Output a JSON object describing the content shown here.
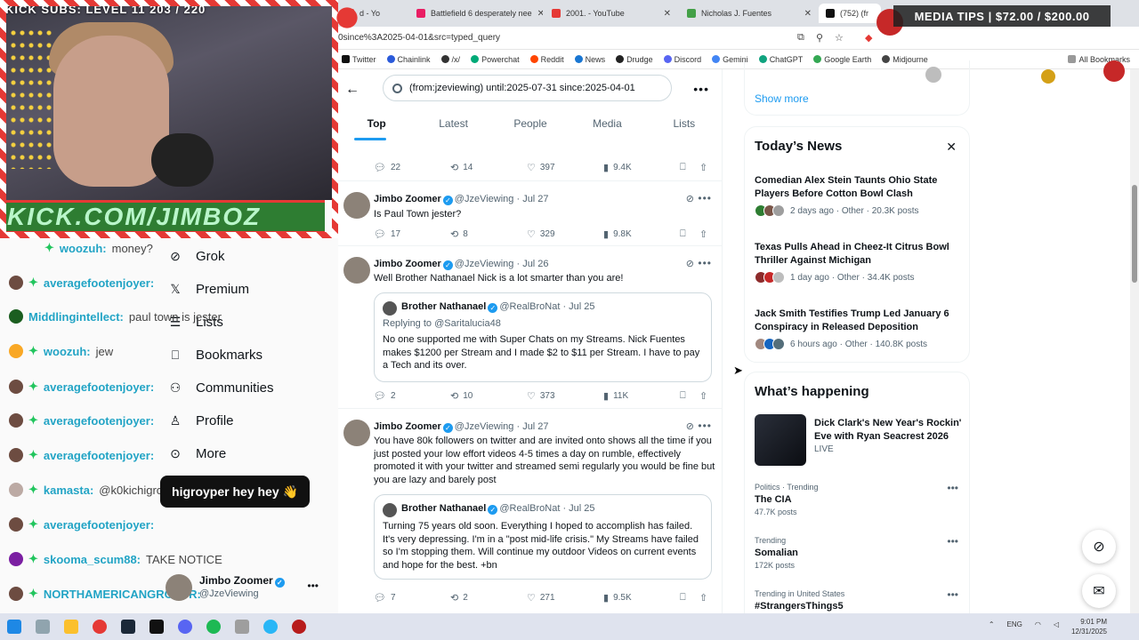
{
  "browser": {
    "tabs": [
      {
        "label": "d - Yo",
        "color": "#e53935"
      },
      {
        "label": "Battlefield 6 desperately nee",
        "color": "#e91e63"
      },
      {
        "label": "2001. - YouTube",
        "color": "#e53935"
      },
      {
        "label": "Nicholas J. Fuentes",
        "color": "#43a047"
      },
      {
        "label": "(752) (fr",
        "color": "#111111"
      }
    ],
    "url": "0since%3A2025-04-01&src=typed_query",
    "bookmarks": [
      "Twitter",
      "Chainlink",
      "/x/",
      "Powerchat",
      "Reddit",
      "News",
      "Drudge",
      "Discord",
      "Gemini",
      "ChatGPT",
      "Google Earth",
      "Midjourne"
    ],
    "all_bookmarks": "All Bookmarks"
  },
  "search": {
    "query": "(from:jzeviewing) until:2025-07-31 since:2025-04-01",
    "tabs": [
      "Top",
      "Latest",
      "People",
      "Media",
      "Lists"
    ]
  },
  "first_actions": {
    "replies": "22",
    "reposts": "14",
    "likes": "397",
    "views": "9.4K"
  },
  "tweets": [
    {
      "name": "Jimbo Zoomer",
      "handle": "@JzeViewing",
      "date": "· Jul 27",
      "text": "Is Paul Town jester?",
      "replies": "17",
      "reposts": "8",
      "likes": "329",
      "views": "9.8K"
    },
    {
      "name": "Jimbo Zoomer",
      "handle": "@JzeViewing",
      "date": "· Jul 26",
      "text": "Well Brother Nathanael Nick is a lot smarter than you are!",
      "quote": {
        "name": "Brother Nathanael",
        "handle": "@RealBroNat",
        "date": "· Jul 25",
        "reply": "Replying to @Saritalucia48",
        "text": "No one supported me with Super Chats on my Streams. Nick Fuentes makes $1200 per Stream and I made $2 to $11 per Stream. I have to pay a Tech and its over."
      },
      "replies": "2",
      "reposts": "10",
      "likes": "373",
      "views": "11K"
    },
    {
      "name": "Jimbo Zoomer",
      "handle": "@JzeViewing",
      "date": "· Jul 27",
      "text": "You have 80k followers on twitter and are invited onto shows all the time if you just posted your low effort videos 4-5 times a day on rumble, effectively promoted it with your twitter and streamed semi regularly you would be fine but you are lazy and barely post",
      "quote": {
        "name": "Brother Nathanael",
        "handle": "@RealBroNat",
        "date": "· Jul 25",
        "text": "Turning 75 years old soon. Everything I hoped to accomplish has failed. It's very depressing. I'm in a \"post mid-life crisis.\" My Streams have failed so I'm stopping them. Will continue my outdoor Videos on current events and hope for the best. +bn"
      },
      "replies": "7",
      "reposts": "2",
      "likes": "271",
      "views": "9.5K"
    }
  ],
  "sidebar": {
    "show_more": "Show more",
    "news_title": "Today’s News",
    "news": [
      {
        "title": "Comedian Alex Stein Taunts Ohio State Players Before Cotton Bowl Clash",
        "meta": "2 days ago · Other · 20.3K posts"
      },
      {
        "title": "Texas Pulls Ahead in Cheez-It Citrus Bowl Thriller Against Michigan",
        "meta": "1 day ago · Other · 34.4K posts"
      },
      {
        "title": "Jack Smith Testifies Trump Led January 6 Conspiracy in Released Deposition",
        "meta": "6 hours ago · Other · 140.8K posts"
      }
    ],
    "happening_title": "What’s happening",
    "featured": {
      "title": "Dick Clark's New Year's Rockin' Eve with Ryan Seacrest 2026",
      "status": "LIVE"
    },
    "trends": [
      {
        "context": "Politics · Trending",
        "name": "The CIA",
        "posts": "47.7K posts"
      },
      {
        "context": "Trending",
        "name": "Somalian",
        "posts": "172K posts"
      },
      {
        "context": "Trending in United States",
        "name": "#StrangersThings5",
        "posts": ""
      }
    ]
  },
  "overlay": {
    "kick_subs": "KICK SUBS: LEVEL 11 203 / 220",
    "banner": "KICK.COM/JIMBOZ",
    "media_tips": "MEDIA TIPS | $72.00 / $200.00",
    "nav": [
      "Grok",
      "Premium",
      "Lists",
      "Bookmarks",
      "Communities",
      "Profile",
      "More"
    ],
    "chat": [
      {
        "user": "woozuh:",
        "msg": "money?"
      },
      {
        "user": "averagefootenjoyer:",
        "msg": ""
      },
      {
        "user": "Middlingintellect:",
        "msg": "paul town is jester"
      },
      {
        "user": "woozuh:",
        "msg": "jew"
      },
      {
        "user": "averagefootenjoyer:",
        "msg": ""
      },
      {
        "user": "averagefootenjoyer:",
        "msg": ""
      },
      {
        "user": "averagefootenjoyer:",
        "msg": ""
      },
      {
        "user": "kamasta:",
        "msg": "@k0kichigroyper hey hey"
      },
      {
        "user": "averagefootenjoyer:",
        "msg": ""
      },
      {
        "user": "skooma_scum88:",
        "msg": "TAKE NOTICE"
      },
      {
        "user": "NORTHAMERICANGROYPR:",
        "msg": ""
      }
    ],
    "highlight": "higroyper hey hey 👋",
    "account": {
      "name": "Jimbo Zoomer",
      "handle": "@JzeViewing"
    }
  },
  "taskbar": {
    "lang": "ENG",
    "time": "9:01 PM",
    "date": "12/31/2025"
  }
}
